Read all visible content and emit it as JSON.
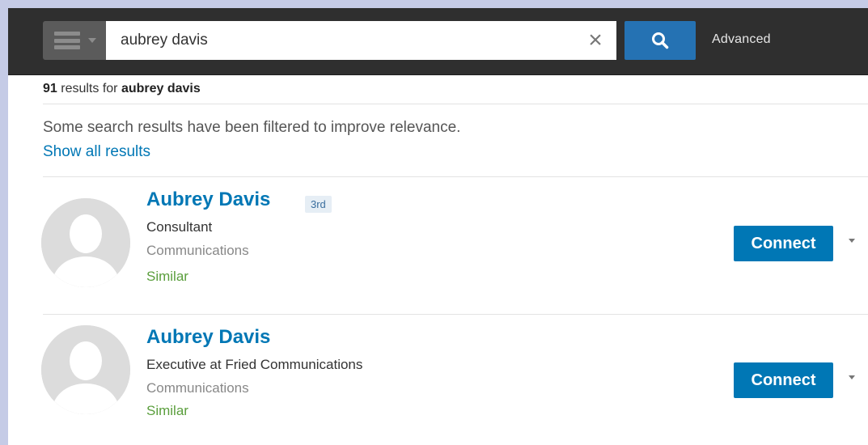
{
  "search": {
    "value": "aubrey davis",
    "placeholder": "",
    "clear_symbol": "×",
    "advanced_label": "Advanced"
  },
  "results": {
    "count": "91",
    "for_text": " results for ",
    "query": "aubrey davis",
    "filtered_notice": "Some search results have been filtered to improve relevance.",
    "show_all_label": "Show all results",
    "items": [
      {
        "name": "Aubrey Davis",
        "degree": "3rd",
        "headline": "Consultant",
        "industry": "Communications",
        "similar_label": "Similar",
        "connect_label": "Connect"
      },
      {
        "name": "Aubrey Davis",
        "degree": "",
        "headline": "Executive at Fried Communications",
        "industry": "Communications",
        "similar_label": "Similar",
        "connect_label": "Connect"
      }
    ]
  },
  "colors": {
    "brand_blue": "#0077b5",
    "topbar": "#2f2f2f",
    "search_button": "#2572b3",
    "similar_green": "#5a9e3c",
    "page_border": "#c5cbe6"
  },
  "icons": {
    "menu": "menu-icon",
    "clear": "close-icon",
    "search": "search-icon",
    "avatar": "avatar-placeholder-icon",
    "dropdown": "chevron-down-icon"
  }
}
